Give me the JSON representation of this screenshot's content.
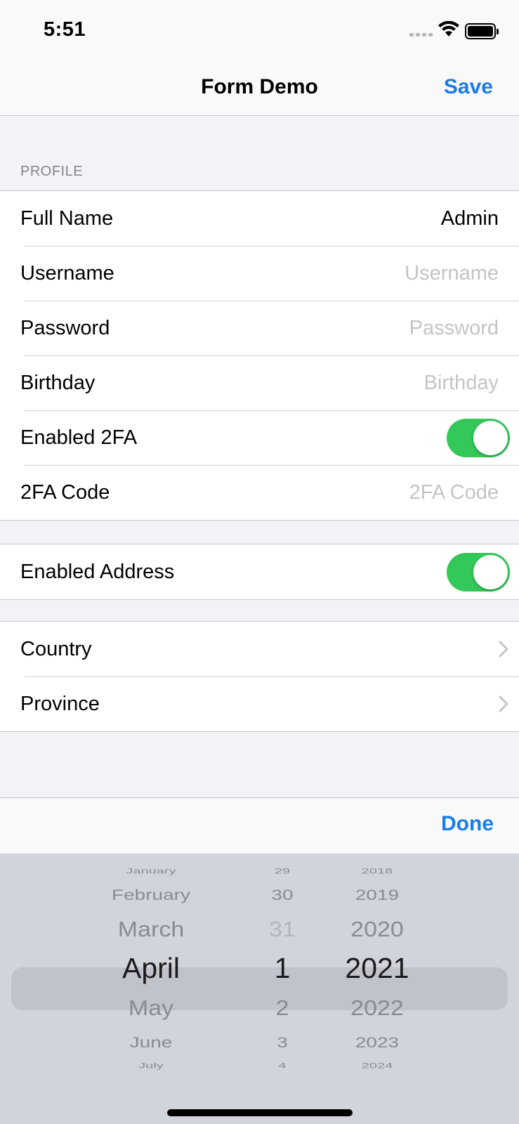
{
  "status": {
    "time": "5:51"
  },
  "nav": {
    "title": "Form Demo",
    "save_label": "Save"
  },
  "profile": {
    "header": "PROFILE",
    "rows": [
      {
        "label": "Full Name",
        "value": "Admin"
      },
      {
        "label": "Username",
        "placeholder": "Username"
      },
      {
        "label": "Password",
        "placeholder": "Password"
      },
      {
        "label": "Birthday",
        "placeholder": "Birthday"
      },
      {
        "label": "Enabled 2FA",
        "toggle_on": true
      },
      {
        "label": "2FA Code",
        "placeholder": "2FA Code"
      }
    ]
  },
  "address": {
    "toggle_label": "Enabled Address",
    "toggle_on": true
  },
  "location": {
    "country_label": "Country",
    "province_label": "Province"
  },
  "toolbar": {
    "done_label": "Done"
  },
  "date_picker": {
    "months": [
      "January",
      "February",
      "March",
      "April",
      "May",
      "June",
      "July"
    ],
    "days": [
      "29",
      "30",
      "31",
      "1",
      "2",
      "3",
      "4"
    ],
    "years": [
      "2018",
      "2019",
      "2020",
      "2021",
      "2022",
      "2023",
      "2024"
    ],
    "selected": {
      "month": "April",
      "day": "1",
      "year": "2021"
    }
  },
  "colors": {
    "accent": "#1a7ce8",
    "toggle_on": "#34c759",
    "placeholder": "#c4c4c7"
  }
}
